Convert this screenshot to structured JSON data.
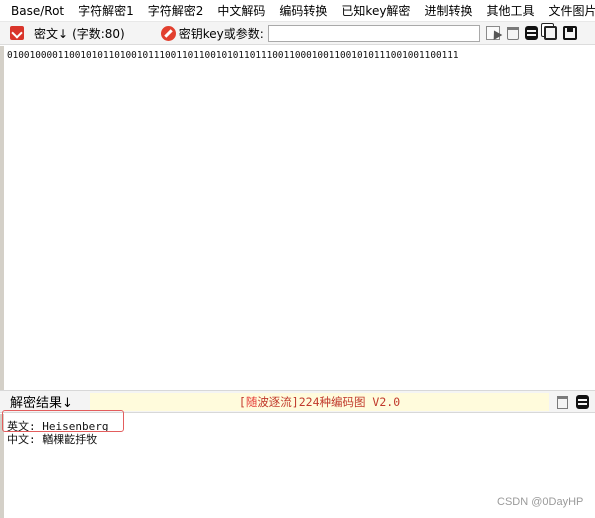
{
  "menu": [
    "Base/Rot",
    "字符解密1",
    "字符解密2",
    "中文解码",
    "编码转换",
    "已知key解密",
    "进制转换",
    "其他工具",
    "文件图片"
  ],
  "toolbar": {
    "cipher_label": "密文↓",
    "count_label": "(字数:80)",
    "key_label": "密钥key或参数:",
    "key_value": ""
  },
  "cipher_text": "01001000011001010110100101110011011001010110111001100010011001010111001001100111",
  "result_bar": {
    "label": "解密结果↓",
    "banner_prefix": "[",
    "banner_highlight": "随",
    "banner_rest": "波逐流]224种编码图 V2.0"
  },
  "results": {
    "english": "英文: Heisenberg",
    "chinese": "中文: 輶棵齕抙牧"
  },
  "watermark": "CSDN @0DayHP",
  "icons": [
    "decode-icon",
    "edit-key-icon",
    "select-cursor-icon",
    "trash-icon",
    "stack-icon",
    "copy-icon",
    "save-icon"
  ]
}
